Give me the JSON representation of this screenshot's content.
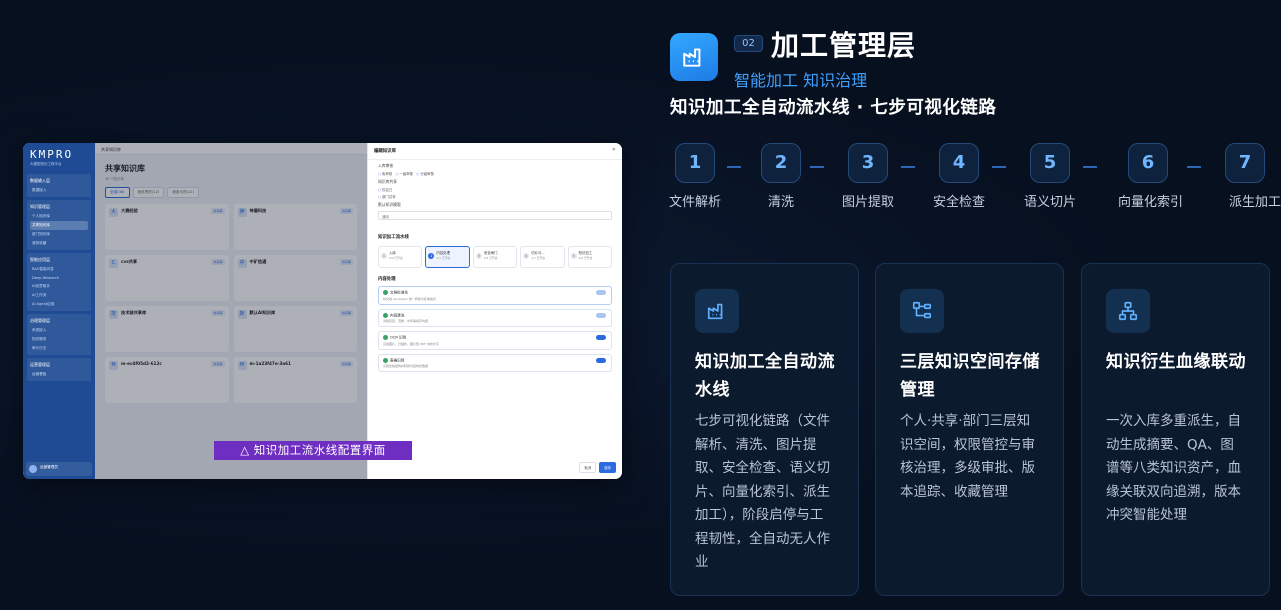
{
  "header": {
    "num": "02",
    "title": "加工管理层",
    "subtitle": "智能加工 知识治理",
    "tagline": "知识加工全自动流水线 · 七步可视化链路"
  },
  "steps": [
    {
      "n": "1",
      "label": "文件解析"
    },
    {
      "n": "2",
      "label": "清洗"
    },
    {
      "n": "3",
      "label": "图片提取"
    },
    {
      "n": "4",
      "label": "安全检查"
    },
    {
      "n": "5",
      "label": "语义切片"
    },
    {
      "n": "6",
      "label": "向量化索引"
    },
    {
      "n": "7",
      "label": "派生加工"
    }
  ],
  "cards": [
    {
      "icon": "factory-icon",
      "title": "知识加工全自动流水线",
      "desc": "七步可视化链路（文件解析、清洗、图片提取、安全检查、语义切片、向量化索引、派生加工），阶段启停与工程韧性，全自动无人作业"
    },
    {
      "icon": "tree-structure-icon",
      "title": "三层知识空间存储管理",
      "desc": "个人·共享·部门三层知识空间，权限管控与审核治理，多级审批、版本追踪、收藏管理"
    },
    {
      "icon": "lineage-network-icon",
      "title": "知识衍生血缘联动",
      "desc": "一次入库多重派生，自动生成摘要、QA、图谱等八类知识资产，血缘关联双向追溯，版本冲突智能处理"
    }
  ],
  "screenshot": {
    "caption": "△ 知识加工流水线配置界面",
    "logo": "KMPRO",
    "logo_sub": "大模型知识工程平台",
    "top_crumb": "共享知识库",
    "page_title": "共享知识库",
    "page_meta": "36 个知识库",
    "tabs": [
      "全部(36)",
      "我负责的(12)",
      "我参与的(11)"
    ],
    "sidebar": [
      {
        "head": "数据输入层",
        "items": [
          "数据接入"
        ]
      },
      {
        "head": "知识管理层",
        "items": [
          "个人知识库",
          "共享知识库",
          "部门知识库",
          "我的收藏"
        ]
      },
      {
        "head": "智能应用层",
        "items": [
          "RAG智能问答",
          "Deep Research",
          "AI创意助手",
          "AI工作流",
          "AI Agent应用"
        ]
      },
      {
        "head": "治理管理层",
        "items": [
          "系统接入",
          "知识服务",
          "审计日志"
        ]
      },
      {
        "head": "运营管理层",
        "items": [
          "运营看板"
        ]
      }
    ],
    "user": "运营管理员",
    "cards": [
      {
        "av": "大",
        "name": "大赛经验",
        "badge": "共享库"
      },
      {
        "av": "神",
        "name": "神盾科技",
        "badge": "共享库"
      },
      {
        "av": "C",
        "name": "cvs共享",
        "badge": "共享库"
      },
      {
        "av": "中",
        "name": "中矿信通",
        "badge": "共享库"
      },
      {
        "av": "技",
        "name": "技术部共享库",
        "badge": "共享库"
      },
      {
        "av": "默",
        "name": "默认AI知识库",
        "badge": "共享库"
      },
      {
        "av": "M",
        "name": "m-ec4f05d2-612c",
        "badge": "共享库"
      },
      {
        "av": "M",
        "name": "m-1a23f47e-3a61",
        "badge": "共享库"
      }
    ],
    "drawer": {
      "title": "编辑知识库",
      "sec1": "入库审核",
      "radios1": [
        "免审核",
        "一级审核",
        "分级审核"
      ],
      "sec2": "知识库共享",
      "radios2": [
        "仅自己",
        "部门共享"
      ],
      "sec3": "默认知识模版",
      "select": "通用",
      "h2": "知识加工流水线",
      "steps": [
        {
          "n": "1",
          "label": "入库",
          "sub": "0/0 已开启"
        },
        {
          "n": "2",
          "label": "内容处理",
          "sub": "4/4 已开启"
        },
        {
          "n": "3",
          "label": "安全闸门",
          "sub": "0/4 已开启"
        },
        {
          "n": "4",
          "label": "切片与...",
          "sub": "1/7 已开启"
        },
        {
          "n": "5",
          "label": "知识加工",
          "sub": "0/8 已开启"
        }
      ],
      "h3": "内容处理",
      "rows": [
        {
          "name": "文档标准化",
          "desc": "将文档 docx/pptx 统一转换为标准格式"
        },
        {
          "name": "内容清洗",
          "desc": "清除页眉、页脚、水印等噪声内容"
        },
        {
          "name": "OCR 识别",
          "desc": "识别图片、扫描件、图片型 PDF 中的文字"
        },
        {
          "name": "表格识别",
          "desc": "识别表格结构并转换为结构化数据"
        }
      ],
      "cancel": "取消",
      "save": "保存"
    }
  },
  "colors": {
    "background": "#07101f",
    "accent": "#3ea0ff",
    "card_bg": "#0c1a2e",
    "caption_bg": "#6e2ec2"
  }
}
